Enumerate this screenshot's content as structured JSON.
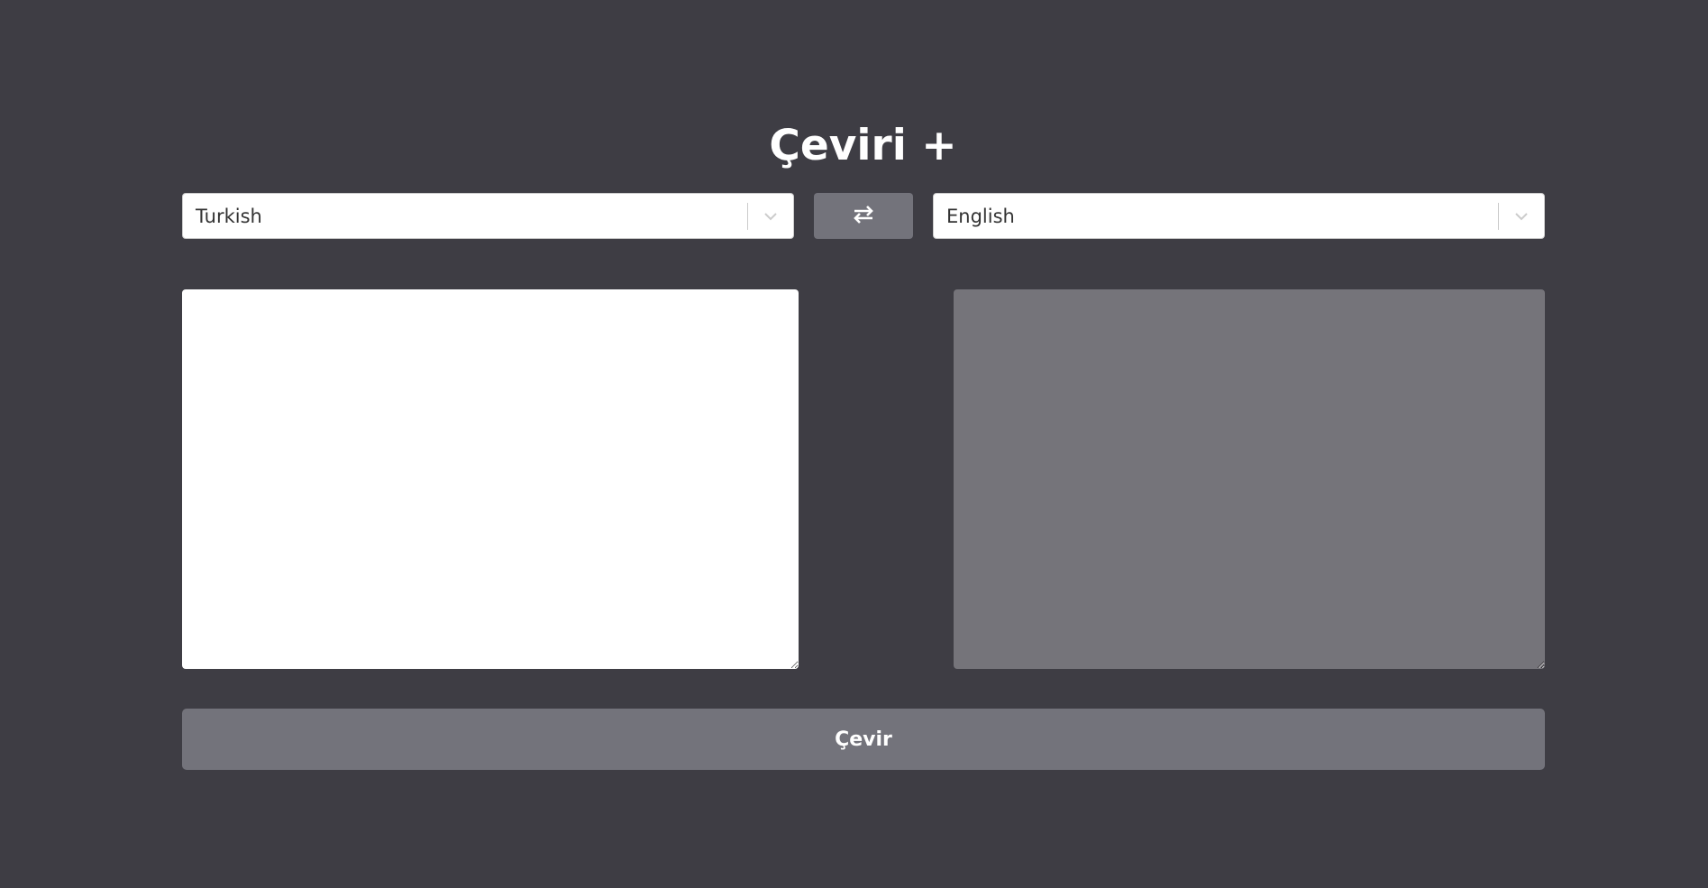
{
  "app": {
    "title": "Çeviri +"
  },
  "languages": {
    "source": "Turkish",
    "target": "English"
  },
  "editor": {
    "source_text": "",
    "target_text": ""
  },
  "actions": {
    "translate_label": "Çevir"
  },
  "icons": {
    "swap": "swap-arrows-icon",
    "chevron": "chevron-down-icon"
  },
  "colors": {
    "background": "#3e3d44",
    "button": "#73737b",
    "output_panel": "#75747a"
  }
}
